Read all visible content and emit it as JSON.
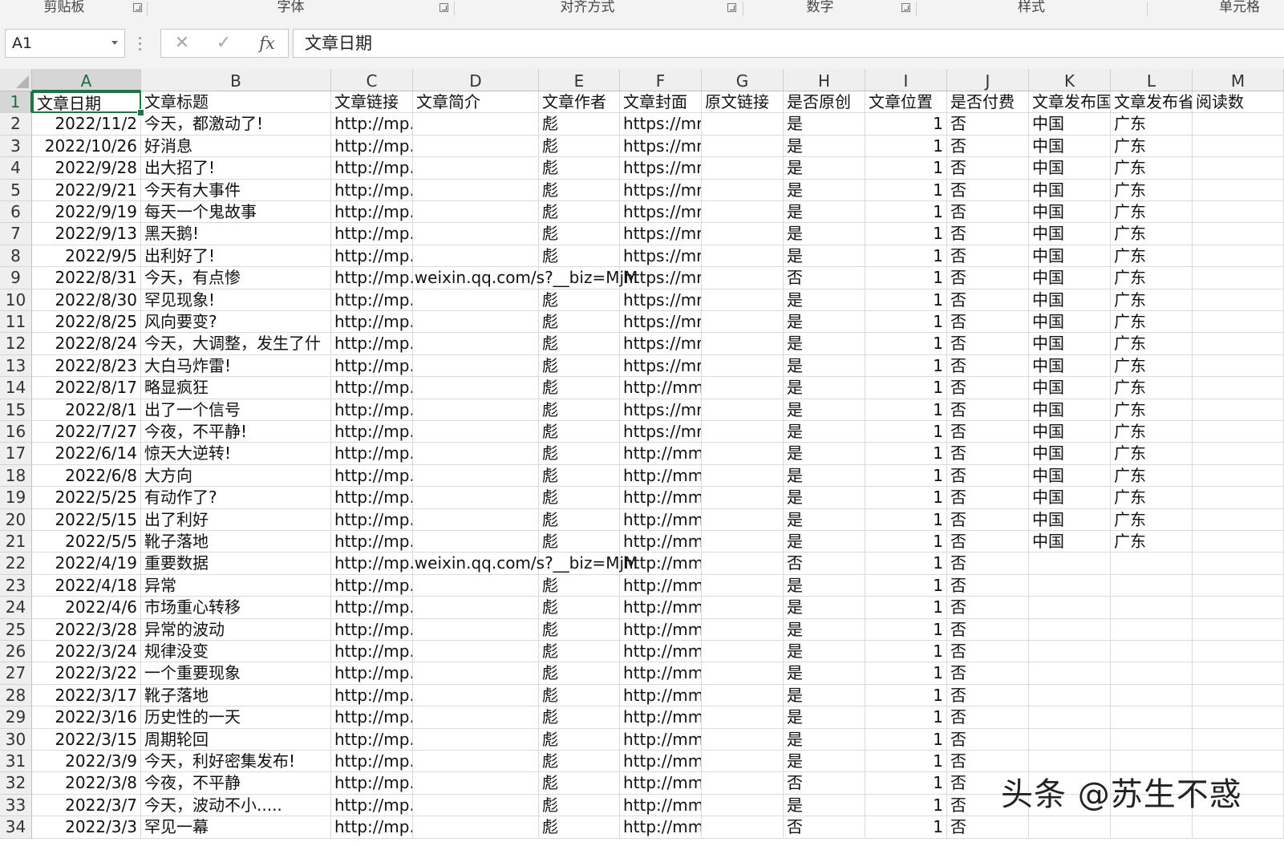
{
  "ribbon": {
    "groups": [
      {
        "label": "剪贴板"
      },
      {
        "label": "字体"
      },
      {
        "label": "对齐方式"
      },
      {
        "label": "数字"
      },
      {
        "label": "样式"
      },
      {
        "label": "单元格"
      }
    ]
  },
  "formula_bar": {
    "name_box": "A1",
    "cancel_icon": "✕",
    "enter_icon": "✓",
    "fx_label": "fx",
    "content": "文章日期"
  },
  "columns": [
    "A",
    "B",
    "C",
    "D",
    "E",
    "F",
    "G",
    "H",
    "I",
    "J",
    "K",
    "L",
    "M"
  ],
  "rows": [
    {
      "n": "1",
      "c": [
        "文章日期",
        "文章标题",
        "文章链接",
        "文章简介",
        "文章作者",
        "文章封面",
        "原文链接",
        "是否原创",
        "文章位置",
        "是否付费",
        "文章发布国",
        "文章发布省",
        "阅读数"
      ]
    },
    {
      "n": "2",
      "c": [
        "2022/11/2",
        "今天，都激动了!",
        "http://mp.weixin.qq.com/s?",
        "",
        "彪",
        "https://mmbiz.qpic.cn",
        "",
        "是",
        "1",
        "否",
        "中国",
        "广东",
        ""
      ]
    },
    {
      "n": "3",
      "c": [
        "2022/10/26",
        "好消息",
        "http://mp.weixin.qq.com/s?",
        "",
        "彪",
        "https://mmbiz.qpic.cn",
        "",
        "是",
        "1",
        "否",
        "中国",
        "广东",
        ""
      ]
    },
    {
      "n": "4",
      "c": [
        "2022/9/28",
        "出大招了!",
        "http://mp.weixin.qq.com/s?",
        "",
        "彪",
        "https://mmbiz.qpic.cn",
        "",
        "是",
        "1",
        "否",
        "中国",
        "广东",
        ""
      ]
    },
    {
      "n": "5",
      "c": [
        "2022/9/21",
        "今天有大事件",
        "http://mp.weixin.qq.com/s?",
        "",
        "彪",
        "https://mmbiz.qpic.cn",
        "",
        "是",
        "1",
        "否",
        "中国",
        "广东",
        ""
      ]
    },
    {
      "n": "6",
      "c": [
        "2022/9/19",
        "每天一个鬼故事",
        "http://mp.weixin.qq.com/s?",
        "",
        "彪",
        "https://mmbiz.qpic.cn",
        "",
        "是",
        "1",
        "否",
        "中国",
        "广东",
        ""
      ]
    },
    {
      "n": "7",
      "c": [
        "2022/9/13",
        "黑天鹅!",
        "http://mp.weixin.qq.com/s?",
        "",
        "彪",
        "https://mmbiz.qpic.cn",
        "",
        "是",
        "1",
        "否",
        "中国",
        "广东",
        ""
      ]
    },
    {
      "n": "8",
      "c": [
        "2022/9/5",
        "出利好了!",
        "http://mp.weixin.qq.com/s?",
        "",
        "彪",
        "https://mmbiz.qpic.cn",
        "",
        "是",
        "1",
        "否",
        "中国",
        "广东",
        ""
      ]
    },
    {
      "n": "9",
      "c": [
        "2022/8/31",
        "今天，有点惨",
        "http://mp.weixin.qq.com/s?__biz=MjM",
        "",
        "",
        "https://mmbiz.qpic.cn",
        "",
        "否",
        "1",
        "否",
        "中国",
        "广东",
        ""
      ]
    },
    {
      "n": "10",
      "c": [
        "2022/8/30",
        "罕见现象!",
        "http://mp.weixin.qq.com/s?",
        "",
        "彪",
        "https://mmbiz.qpic.cn",
        "",
        "是",
        "1",
        "否",
        "中国",
        "广东",
        ""
      ]
    },
    {
      "n": "11",
      "c": [
        "2022/8/25",
        "风向要变?",
        "http://mp.weixin.qq.com/s?",
        "",
        "彪",
        "https://mmbiz.qpic.cn",
        "",
        "是",
        "1",
        "否",
        "中国",
        "广东",
        ""
      ]
    },
    {
      "n": "12",
      "c": [
        "2022/8/24",
        "今天，大调整，发生了什",
        "http://mp.weixin.qq.com/s?",
        "",
        "彪",
        "https://mmbiz.qpic.cn",
        "",
        "是",
        "1",
        "否",
        "中国",
        "广东",
        ""
      ]
    },
    {
      "n": "13",
      "c": [
        "2022/8/23",
        "大白马炸雷!",
        "http://mp.weixin.qq.com/s?",
        "",
        "彪",
        "https://mmbiz.qpic.cn",
        "",
        "是",
        "1",
        "否",
        "中国",
        "广东",
        ""
      ]
    },
    {
      "n": "14",
      "c": [
        "2022/8/17",
        "略显疯狂",
        "http://mp.weixin.qq.com/s?",
        "",
        "彪",
        "http://mmbiz.qpic.cn/",
        "",
        "是",
        "1",
        "否",
        "中国",
        "广东",
        ""
      ]
    },
    {
      "n": "15",
      "c": [
        "2022/8/1",
        "出了一个信号",
        "http://mp.weixin.qq.com/s?",
        "",
        "彪",
        "https://mmbiz.qpic.cn",
        "",
        "是",
        "1",
        "否",
        "中国",
        "广东",
        ""
      ]
    },
    {
      "n": "16",
      "c": [
        "2022/7/27",
        "今夜，不平静!",
        "http://mp.weixin.qq.com/s?",
        "",
        "彪",
        "https://mmbiz.qpic.cn",
        "",
        "是",
        "1",
        "否",
        "中国",
        "广东",
        ""
      ]
    },
    {
      "n": "17",
      "c": [
        "2022/6/14",
        "惊天大逆转!",
        "http://mp.weixin.qq.com/s?",
        "",
        "彪",
        "http://mmbiz.qpic.cn/",
        "",
        "是",
        "1",
        "否",
        "中国",
        "广东",
        ""
      ]
    },
    {
      "n": "18",
      "c": [
        "2022/6/8",
        "大方向",
        "http://mp.weixin.qq.com/s?",
        "",
        "彪",
        "http://mmbiz.qpic.cn/",
        "",
        "是",
        "1",
        "否",
        "中国",
        "广东",
        ""
      ]
    },
    {
      "n": "19",
      "c": [
        "2022/5/25",
        "有动作了?",
        "http://mp.weixin.qq.com/s?",
        "",
        "彪",
        "http://mmbiz.qpic.cn/",
        "",
        "是",
        "1",
        "否",
        "中国",
        "广东",
        ""
      ]
    },
    {
      "n": "20",
      "c": [
        "2022/5/15",
        "出了利好",
        "http://mp.weixin.qq.com/s?",
        "",
        "彪",
        "http://mmbiz.qpic.cn/",
        "",
        "是",
        "1",
        "否",
        "中国",
        "广东",
        ""
      ]
    },
    {
      "n": "21",
      "c": [
        "2022/5/5",
        "靴子落地",
        "http://mp.weixin.qq.com/s?",
        "",
        "彪",
        "http://mmbiz.qpic.cn/",
        "",
        "是",
        "1",
        "否",
        "中国",
        "广东",
        ""
      ]
    },
    {
      "n": "22",
      "c": [
        "2022/4/19",
        "重要数据",
        "http://mp.weixin.qq.com/s?__biz=MjM",
        "",
        "",
        "http://mmbiz.qpic.cn/",
        "",
        "否",
        "1",
        "否",
        "",
        "",
        ""
      ]
    },
    {
      "n": "23",
      "c": [
        "2022/4/18",
        "异常",
        "http://mp.weixin.qq.com/s?",
        "",
        "彪",
        "http://mmbiz.qpic.cn/",
        "",
        "是",
        "1",
        "否",
        "",
        "",
        ""
      ]
    },
    {
      "n": "24",
      "c": [
        "2022/4/6",
        "市场重心转移",
        "http://mp.weixin.qq.com/s?",
        "",
        "彪",
        "http://mmbiz.qpic.cn/",
        "",
        "是",
        "1",
        "否",
        "",
        "",
        ""
      ]
    },
    {
      "n": "25",
      "c": [
        "2022/3/28",
        "异常的波动",
        "http://mp.weixin.qq.com/s?",
        "",
        "彪",
        "http://mmbiz.qpic.cn/",
        "",
        "是",
        "1",
        "否",
        "",
        "",
        ""
      ]
    },
    {
      "n": "26",
      "c": [
        "2022/3/24",
        "规律没变",
        "http://mp.weixin.qq.com/s?",
        "",
        "彪",
        "http://mmbiz.qpic.cn/",
        "",
        "是",
        "1",
        "否",
        "",
        "",
        ""
      ]
    },
    {
      "n": "27",
      "c": [
        "2022/3/22",
        "一个重要现象",
        "http://mp.weixin.qq.com/s?",
        "",
        "彪",
        "http://mmbiz.qpic.cn/",
        "",
        "是",
        "1",
        "否",
        "",
        "",
        ""
      ]
    },
    {
      "n": "28",
      "c": [
        "2022/3/17",
        "靴子落地",
        "http://mp.weixin.qq.com/s?",
        "",
        "彪",
        "http://mmbiz.qpic.cn/",
        "",
        "是",
        "1",
        "否",
        "",
        "",
        ""
      ]
    },
    {
      "n": "29",
      "c": [
        "2022/3/16",
        "历史性的一天",
        "http://mp.weixin.qq.com/s?",
        "",
        "彪",
        "http://mmbiz.qpic.cn/",
        "",
        "是",
        "1",
        "否",
        "",
        "",
        ""
      ]
    },
    {
      "n": "30",
      "c": [
        "2022/3/15",
        "周期轮回",
        "http://mp.weixin.qq.com/s?",
        "",
        "彪",
        "http://mmbiz.qpic.cn/",
        "",
        "是",
        "1",
        "否",
        "",
        "",
        ""
      ]
    },
    {
      "n": "31",
      "c": [
        "2022/3/9",
        "今天，利好密集发布!",
        "http://mp.weixin.qq.com/s?",
        "",
        "彪",
        "http://mmbiz.qpic.cn/",
        "",
        "是",
        "1",
        "否",
        "",
        "",
        ""
      ]
    },
    {
      "n": "32",
      "c": [
        "2022/3/8",
        "今夜，不平静",
        "http://mp.weixin.qq.com/s?",
        "",
        "彪",
        "http://mmbiz.qpic.cn/",
        "",
        "否",
        "1",
        "否",
        "",
        "",
        ""
      ]
    },
    {
      "n": "33",
      "c": [
        "2022/3/7",
        "今天，波动不小.....",
        "http://mp.weixin.qq.com/s?",
        "",
        "彪",
        "http://mmbiz.qpic.cn/",
        "",
        "是",
        "1",
        "否",
        "",
        "",
        ""
      ]
    },
    {
      "n": "34",
      "c": [
        "2022/3/3",
        "罕见一幕",
        "http://mp.weixin.qq.com/s?",
        "",
        "彪",
        "http://mmbiz.qpic.cn/",
        "",
        "否",
        "1",
        "否",
        "",
        "",
        ""
      ]
    }
  ],
  "watermark": "头条 @苏生不惑",
  "colors": {
    "accent": "#217346"
  }
}
